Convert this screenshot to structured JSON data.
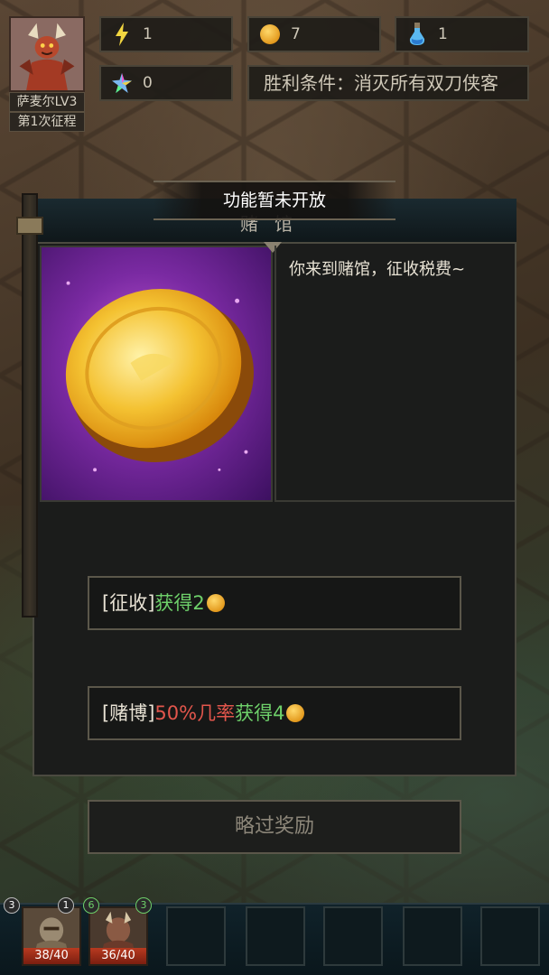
{
  "hud": {
    "hero_name": "萨麦尔LV3",
    "hero_stage": "第1次征程",
    "energy": "1",
    "gold": "7",
    "potion": "1",
    "crystal": "0",
    "victory_condition": "胜利条件：消灭所有双刀侠客"
  },
  "panel": {
    "toast": "功能暂未开放",
    "title": "赌馆",
    "description": "你来到赌馆，征收税费~",
    "option1": {
      "prefix": "[征收]",
      "reward": "获得2"
    },
    "option2": {
      "prefix": "[赌博]",
      "chance": "50%几率",
      "reward": "获得4"
    },
    "skip_label": "略过奖励"
  },
  "units": [
    {
      "level_left": "3",
      "level_right": "1",
      "hp": "38/40"
    },
    {
      "level_left": "6",
      "level_right": "3",
      "hp": "36/40"
    }
  ],
  "colors": {
    "reward_green": "#6ed06a",
    "chance_red": "#e2564c",
    "hp_red": "#b83a20"
  }
}
